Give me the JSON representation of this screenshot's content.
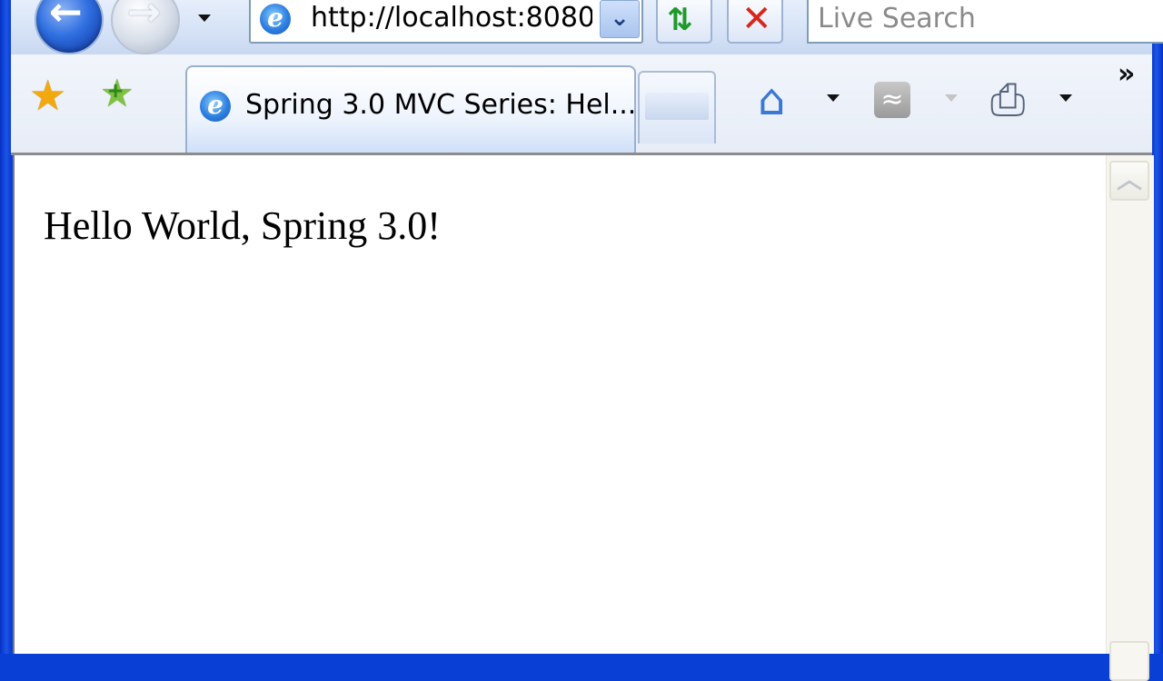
{
  "navigation": {
    "back_icon": "back-arrow-icon",
    "back_glyph": "←",
    "forward_icon": "forward-arrow-icon",
    "forward_glyph": "→"
  },
  "address_bar": {
    "url": "http://localhost:8080/",
    "dropdown_glyph": "⌄",
    "refresh_glyph": "⇅",
    "stop_glyph": "✕"
  },
  "search": {
    "placeholder": "Live Search"
  },
  "favorites": {
    "star_glyph": "★",
    "add_glyph": "★",
    "add_plus": "+"
  },
  "tabs": [
    {
      "title": "Spring 3.0 MVC Series: Hel...",
      "active": true
    }
  ],
  "command_bar": {
    "home_glyph": "⌂",
    "feed_glyph": "≈",
    "print_glyph": "⎙",
    "more_glyph": "»"
  },
  "page": {
    "body_text": "Hello World, Spring 3.0!"
  },
  "scrollbar": {
    "up_glyph": "︿"
  },
  "colors": {
    "window_frame": "#0a3fd6",
    "ie_icon": "#2d7fe0",
    "stop": "#d8261c",
    "refresh": "#1f9a2a"
  }
}
